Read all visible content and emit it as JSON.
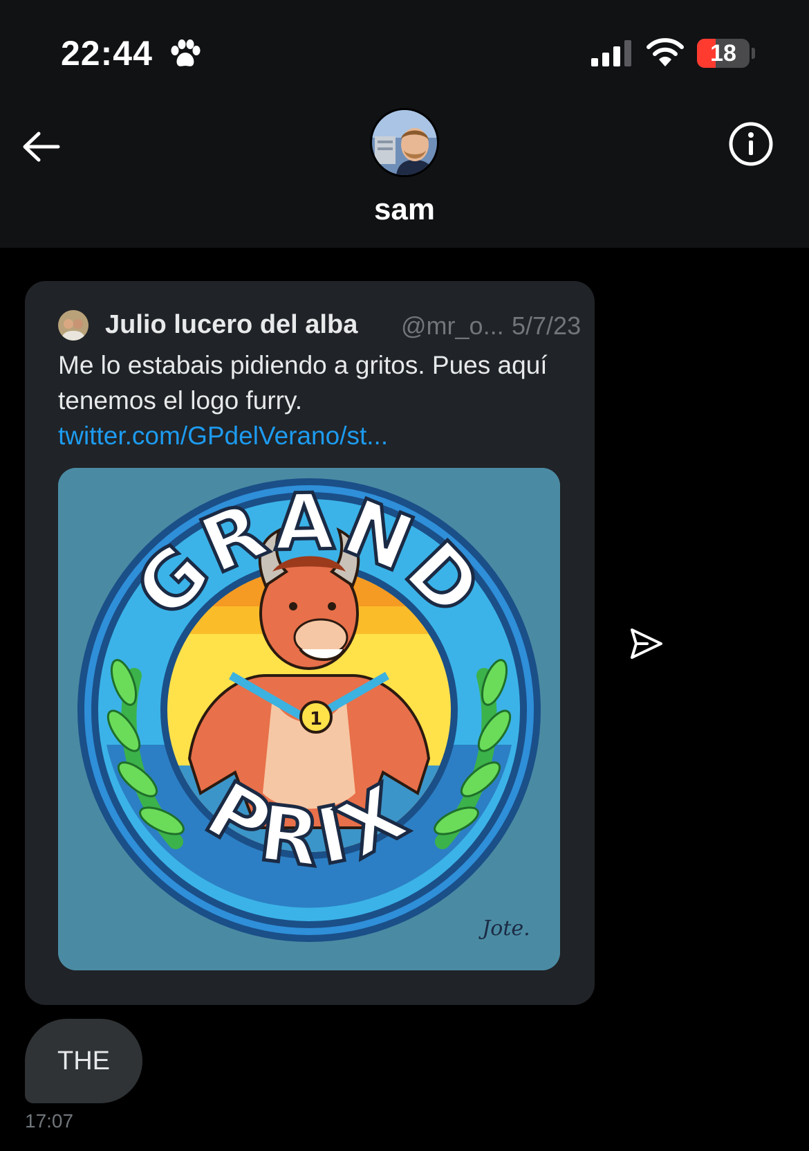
{
  "status_bar": {
    "time": "22:44",
    "status_icon": "paw-icon",
    "battery_level": "18",
    "battery_fraction": 0.18,
    "signal_bars": 3
  },
  "header": {
    "contact_name": "sam",
    "back_icon": "back-arrow-icon",
    "info_icon": "info-icon"
  },
  "tweet": {
    "author": "Julio lucero del alba",
    "handle": "@mr_o...",
    "date": "5/7/23",
    "text": "Me lo estabais pidiendo a gritos. Pues aquí tenemos el logo furry. ",
    "link": "twitter.com/GPdelVerano/st...",
    "media": {
      "logo_text_top": "GRAND",
      "logo_text_bottom": "PRIX",
      "medal_number": "1",
      "signature": "Jote."
    }
  },
  "message": {
    "text": "THE",
    "time": "17:07"
  },
  "colors": {
    "background": "#000000",
    "header_bg": "#111214",
    "card_bg": "#202327",
    "bubble_bg": "#2f3336",
    "link": "#1d9bf0",
    "muted": "#71767b",
    "battery_low": "#ff3b30"
  }
}
